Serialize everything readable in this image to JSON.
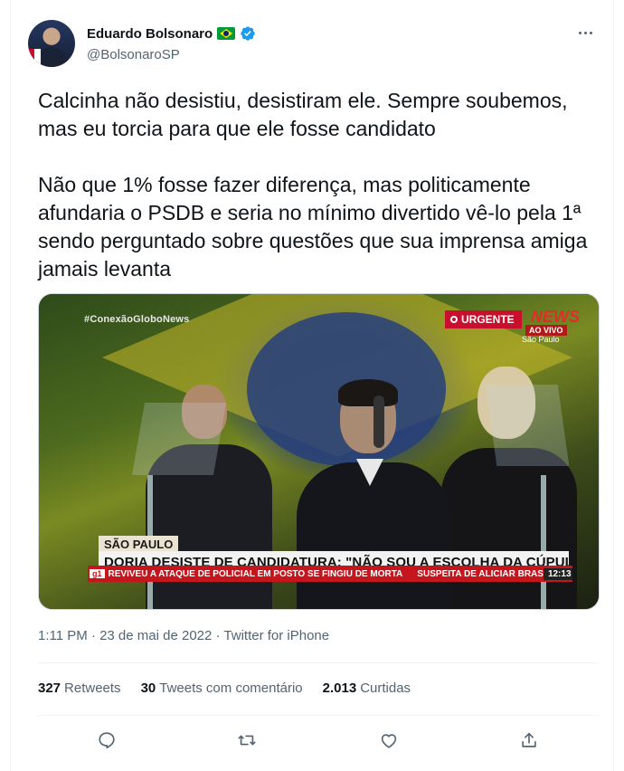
{
  "author": {
    "name": "Eduardo Bolsonaro",
    "handle": "@BolsonaroSP"
  },
  "tweet": {
    "text": "Calcinha não desistiu, desistiram ele. Sempre soubemos, mas eu torcia para que ele fosse candidato\n\nNão que 1% fosse fazer diferença, mas politicamente afundaria o PSDB e seria no mínimo divertido vê-lo pela 1ª sendo perguntado sobre questões que sua imprensa amiga jamais levanta"
  },
  "media": {
    "hashtag": "#ConexãoGloboNews",
    "urgent_label": "URGENTE",
    "channel_logo": "NEWS",
    "live_label": "AO VIVO",
    "location_top": "São Paulo",
    "location_tag": "SÃO PAULO",
    "headline": "DORIA DESISTE DE CANDIDATURA: \"NÃO SOU A ESCOLHA DA CÚPULA DO PSDB\"",
    "ticker_badge": "g1",
    "ticker_1": "REVIVEU A ATAQUE DE POLICIAL EM POSTO SE FINGIU DE MORTA",
    "ticker_2": "SUSPEITA DE ALICIAR BRAS",
    "ticker_time": "12:13"
  },
  "meta": {
    "timestamp": "1:11 PM · 23 de mai de 2022 · Twitter for iPhone"
  },
  "stats": {
    "retweets_count": "327",
    "retweets_label": "Retweets",
    "quotes_count": "30",
    "quotes_label": "Tweets com comentário",
    "likes_count": "2.013",
    "likes_label": "Curtidas"
  },
  "icons": {
    "verified": "verified-badge-icon",
    "more": "more-options-icon",
    "reply": "reply-icon",
    "retweet": "retweet-icon",
    "like": "heart-icon",
    "share": "share-icon"
  },
  "colors": {
    "verified": "#1d9bf0",
    "secondary_text": "#536471",
    "primary_text": "#0f1419",
    "divider": "#eff3f4"
  }
}
